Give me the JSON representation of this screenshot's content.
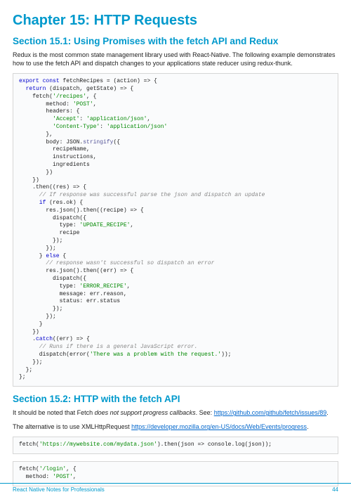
{
  "chapter_title": "Chapter 15: HTTP Requests",
  "section1": {
    "title": "Section 15.1: Using Promises with the fetch API and Redux",
    "para": "Redux is the most common state management library used with React-Native. The following example demonstrates how to use the fetch API and dispatch changes to your applications state reducer using redux-thunk."
  },
  "code1": {
    "l01a": "export",
    "l01b": " const",
    "l01c": " fetchRecipes = (action) => {",
    "l02a": "  return",
    "l02b": " (dispatch, getState) => {",
    "l03a": "    fetch(",
    "l03b": "'/recipes'",
    "l03c": ", {",
    "l04a": "        method: ",
    "l04b": "'POST'",
    "l04c": ",",
    "l05": "        headers: {",
    "l06a": "          ",
    "l06b": "'Accept'",
    "l06c": ": ",
    "l06d": "'application/json'",
    "l06e": ",",
    "l07a": "          ",
    "l07b": "'Content-Type'",
    "l07c": ": ",
    "l07d": "'application/json'",
    "l08": "        },",
    "l09a": "        body: JSON.",
    "l09b": "stringify",
    "l09c": "({",
    "l10": "          recipeName,",
    "l11": "          instructions,",
    "l12": "          ingredients",
    "l13": "        })",
    "l14": "    })",
    "l15a": "    .then((res) => {",
    "l16": "      // If response was successful parse the json and dispatch an update",
    "l17a": "      if",
    "l17b": " (res.ok) {",
    "l18": "        res.json().then((recipe) => {",
    "l19": "          dispatch({",
    "l20a": "            type: ",
    "l20b": "'UPDATE_RECIPE'",
    "l20c": ",",
    "l21": "            recipe",
    "l22": "          });",
    "l23": "        });",
    "l24a": "      } ",
    "l24b": "else",
    "l24c": " {",
    "l25": "        // response wasn't successful so dispatch an error",
    "l26": "        res.json().then((err) => {",
    "l27": "          dispatch({",
    "l28a": "            type: ",
    "l28b": "'ERROR_RECIPE'",
    "l28c": ",",
    "l29": "            message: err.reason,",
    "l30": "            status: err.status",
    "l31": "          });",
    "l32": "        });",
    "l33": "      }",
    "l34": "    })",
    "l35a": "    .",
    "l35b": "catch",
    "l35c": "((err) => {",
    "l36": "      // Runs if there is a general JavaScript error.",
    "l37a": "      dispatch(error(",
    "l37b": "'There was a problem with the request.'",
    "l37c": "));",
    "l38": "    });",
    "l39": "  };",
    "l40": "};"
  },
  "section2": {
    "title": "Section 15.2: HTTP with the fetch API",
    "para1_a": "It should be noted that Fetch ",
    "para1_b": "does not support progress callbacks",
    "para1_c": ". See: ",
    "link1": "https://github.com/github/fetch/issues/89",
    "para1_d": ".",
    "para2_a": "The alternative is to use XMLHttpRequest ",
    "link2": "https://developer.mozilla.org/en-US/docs/Web/Events/progress",
    "para2_b": "."
  },
  "code2": {
    "l1a": "fetch(",
    "l1b": "'https://mywebsite.com/mydata.json'",
    "l1c": ").then(json => console.log(json));"
  },
  "code3": {
    "l1a": "fetch(",
    "l1b": "'/login'",
    "l1c": ", {",
    "l2a": "  method: ",
    "l2b": "'POST'",
    "l2c": ","
  },
  "footer": {
    "left": "React Native Notes for Professionals",
    "right": "44"
  }
}
